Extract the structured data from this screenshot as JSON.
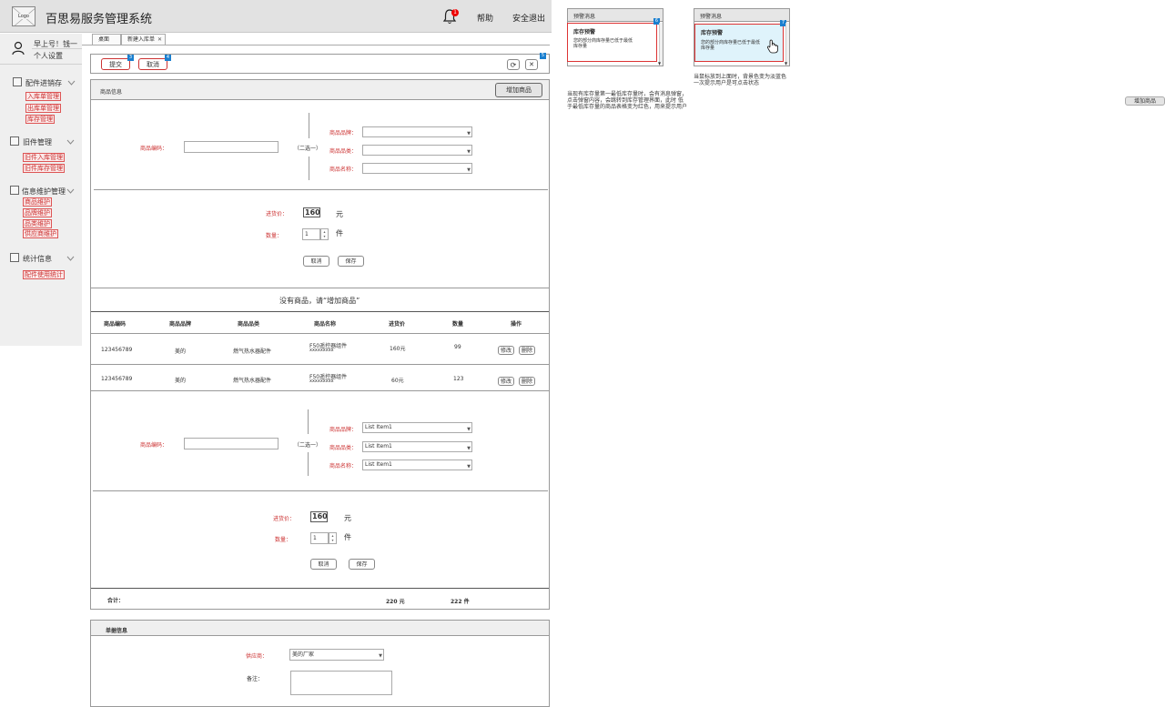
{
  "header": {
    "logo": "Logo",
    "title": "百思易服务管理系统",
    "notif_count": "1",
    "help": "帮助",
    "logout": "安全退出"
  },
  "user": {
    "greeting": "早上号！钱一",
    "settings": "个人设置"
  },
  "sidebar": {
    "groups": [
      {
        "label": "配件进销存",
        "items": [
          "入库单管理",
          "出库单管理",
          "库存管理"
        ]
      },
      {
        "label": "旧件管理",
        "items": [
          "旧件入库管理",
          "旧件库存管理"
        ]
      },
      {
        "label": "信息维护管理",
        "items": [
          "商品维护",
          "品牌维护",
          "品类维护",
          "供应商维护"
        ]
      },
      {
        "label": "统计信息",
        "items": [
          "配件使用统计"
        ]
      }
    ]
  },
  "tabs": [
    {
      "label": "桌面"
    },
    {
      "label": "新建入库单",
      "close": "✕"
    }
  ],
  "toolbar": {
    "submit": "提交",
    "cancel": "取消",
    "badge_submit": "3",
    "badge_cancel": "4",
    "badge_right": "5",
    "refresh_icon": "⟳",
    "close_icon": "✕"
  },
  "goods": {
    "section_title": "商品信息",
    "add_button": "增加商品",
    "form1": {
      "code_label": "商品编码：",
      "either": "（二选一）",
      "brand_label": "商品品牌：",
      "category_label": "商品品类：",
      "name_label": "商品名称：",
      "brand_value": "",
      "category_value": "",
      "name_value": ""
    },
    "price1": {
      "price_label": "进货价：",
      "price_value": "160",
      "price_unit": "元",
      "qty_label": "数量：",
      "qty_value": "1",
      "qty_unit": "件",
      "cancel": "取消",
      "save": "保存"
    },
    "empty_message": "没有商品，请“增加商品”",
    "table": {
      "headers": [
        "商品编码",
        "商品品牌",
        "商品品类",
        "商品名称",
        "进货价",
        "数量",
        "操作"
      ],
      "rows": [
        {
          "code": "123456789",
          "brand": "美的",
          "category": "燃气热水器配件",
          "name": "F50遥控器组件",
          "sub": "xxxxxxxxx",
          "price": "160元",
          "qty": "99",
          "edit": "修改",
          "delete": "删除"
        },
        {
          "code": "123456789",
          "brand": "美的",
          "category": "燃气热水器配件",
          "name": "F50遥控器组件",
          "sub": "xxxxxxxxx",
          "price": "60元",
          "qty": "123",
          "edit": "修改",
          "delete": "删除"
        }
      ]
    },
    "form2": {
      "code_label": "商品编码：",
      "either": "（二选一）",
      "brand_label": "商品品牌：",
      "category_label": "商品品类：",
      "name_label": "商品名称：",
      "brand_value": "List Item1",
      "category_value": "List Item1",
      "name_value": "List Item1"
    },
    "price2": {
      "price_label": "进货价：",
      "price_value": "160",
      "price_unit": "元",
      "qty_label": "数量：",
      "qty_value": "1",
      "qty_unit": "件",
      "cancel": "取消",
      "save": "保存"
    },
    "total": {
      "label": "合计：",
      "amount": "220 元",
      "count": "222 件"
    }
  },
  "order": {
    "section_title": "单据信息",
    "supplier_label": "供应商：",
    "supplier_value": "美的厂家",
    "remark_label": "备注："
  },
  "annotations": {
    "popup1": {
      "header": "预警消息",
      "title": "库存预警",
      "body1": "您的部分商库存量已低于最低",
      "body2": "库存量",
      "badge": "6"
    },
    "popup2": {
      "header": "预警消息",
      "title": "库存预警",
      "body1": "您的部分商库存量已低于最低",
      "body2": "库存量",
      "badge": "7"
    },
    "hover_note1": "当鼠标放到上面时，背景色变为淡蓝色",
    "hover_note2": "一次提示用户是可点击状态",
    "alert_note1": "当现有库存量第一最低库存量时，会有消息弹窗，",
    "alert_note2": "点击弹窗内容，会跳转到库存管理界面，此时 低",
    "alert_note3": "于最低库存量的商品表格变为红色，用来提示用户",
    "add_button_sample": "增加商品"
  },
  "colors": {
    "accent_red": "#cc3333",
    "badge_blue": "#1a7fcf",
    "hover_bg": "#dff3fb"
  }
}
